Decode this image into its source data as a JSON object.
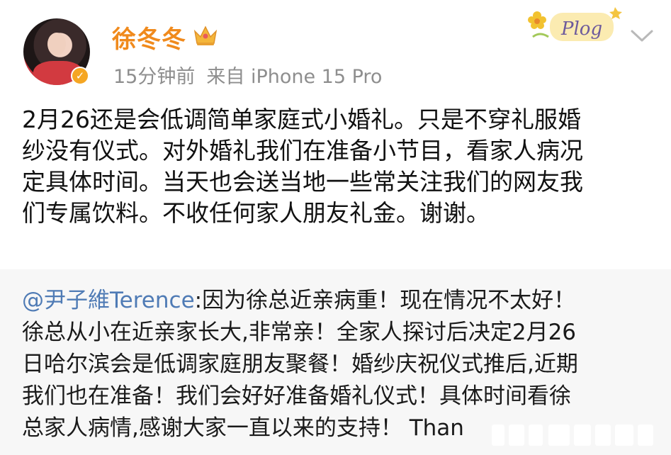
{
  "user": {
    "name": "徐冬冬",
    "time": "15分钟前",
    "source": "来自 iPhone 15 Pro"
  },
  "icons": {
    "crown": "crown-icon",
    "verified": "verified-badge-icon",
    "chevron": "chevron-down-icon",
    "sticker": "plog-sticker-icon"
  },
  "sticker": {
    "text": "Plog"
  },
  "post": {
    "lines": [
      "2月26还是会低调简单家庭式小婚礼。只是不穿礼服婚",
      "纱没有仪式。对外婚礼我们在准备小节目，看家人病况",
      "定具体时间。当天也会送当地一些常关注我们的网友我",
      "们专属饮料。不收任何家人朋友礼金。谢谢。"
    ]
  },
  "repost": {
    "mention": "@尹子維Terence",
    "first_line_rest": ":因为徐总近亲病重！现在情况不太好！",
    "lines": [
      "徐总从小在近亲家长大,非常亲！全家人探讨后决定2月26",
      "日哈尔滨会是低调家庭朋友聚餐！婚纱庆祝仪式推后,近期",
      "我们也在准备！我们会好好准备婚礼仪式！具体时间看徐",
      "总家人病情,感谢大家一直以来的支持！ Than"
    ]
  },
  "colors": {
    "username": "#f08a1c",
    "mention": "#4f7bb5",
    "meta": "#8e8e8e",
    "repost_bg": "#f7f7f7"
  }
}
